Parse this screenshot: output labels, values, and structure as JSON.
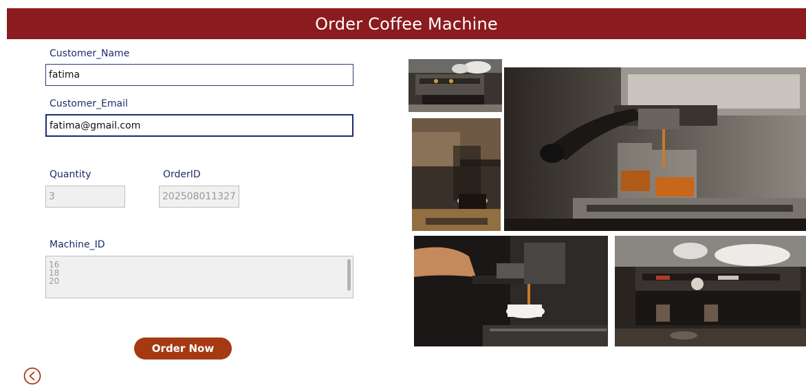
{
  "header": {
    "title": "Order Coffee Machine"
  },
  "form": {
    "customer_name": {
      "label": "Customer_Name",
      "value": "fatima"
    },
    "customer_email": {
      "label": "Customer_Email",
      "value": "fatima@gmail.com"
    },
    "quantity": {
      "label": "Quantity",
      "value": "3"
    },
    "order_id": {
      "label": "OrderID",
      "value": "202508011327"
    },
    "machine_id": {
      "label": "Machine_ID",
      "items": [
        "16",
        "18",
        "20"
      ]
    },
    "submit_label": "Order Now"
  },
  "icons": {
    "back": "chevron-left-circle-icon"
  },
  "colors": {
    "header_bg": "#8b1b1f",
    "button_bg": "#a53a12",
    "label_color": "#1f2a6a"
  }
}
